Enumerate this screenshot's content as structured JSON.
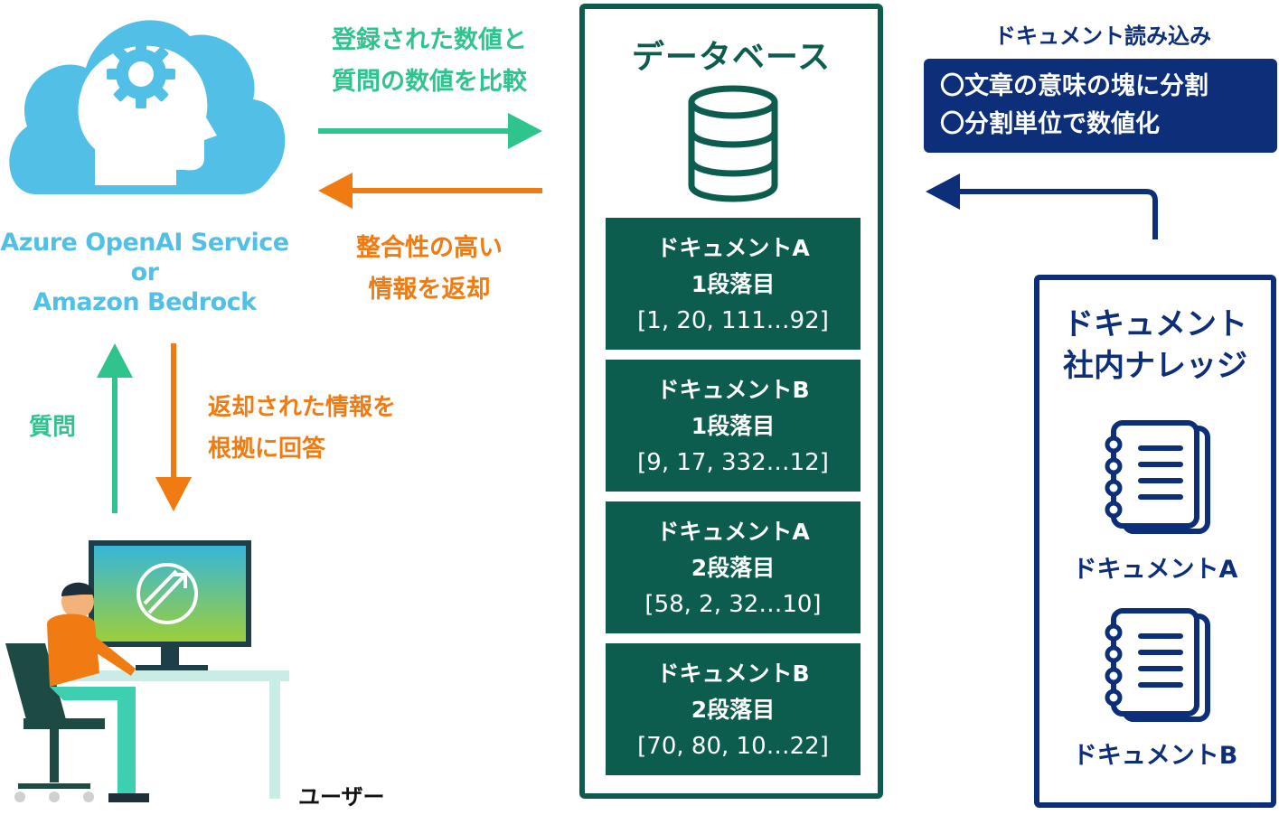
{
  "cloud": {
    "label": "Azure OpenAI Service\nor\nAmazon Bedrock"
  },
  "arrows": {
    "compare_label": "登録された数値と\n質問の数値を比較",
    "return_label": "整合性の高い\n情報を返却",
    "question_label": "質問",
    "answer_label": "返却された情報を\n根拠に回答",
    "load_label": "ドキュメント読み込み"
  },
  "user": {
    "label": "ユーザー"
  },
  "database": {
    "title": "データベース",
    "chunks": [
      {
        "doc": "ドキュメントA",
        "para": "1段落目",
        "vector": "[1, 20, 111…92]"
      },
      {
        "doc": "ドキュメントB",
        "para": "1段落目",
        "vector": "[9, 17, 332…12]"
      },
      {
        "doc": "ドキュメントA",
        "para": "2段落目",
        "vector": "[58, 2, 32…10]"
      },
      {
        "doc": "ドキュメントB",
        "para": "2段落目",
        "vector": "[70, 80, 10…22]"
      }
    ]
  },
  "loading": {
    "lines": [
      "〇文章の意味の塊に分割",
      "〇分割単位で数値化"
    ]
  },
  "knowledge": {
    "title": "ドキュメント\n社内ナレッジ",
    "docs": [
      "ドキュメントA",
      "ドキュメントB"
    ]
  },
  "colors": {
    "cloud": "#52c0e6",
    "green_arrow": "#2fc48e",
    "orange_arrow": "#f07b12",
    "db_green": "#0d5d4e",
    "navy": "#0d2e78"
  }
}
